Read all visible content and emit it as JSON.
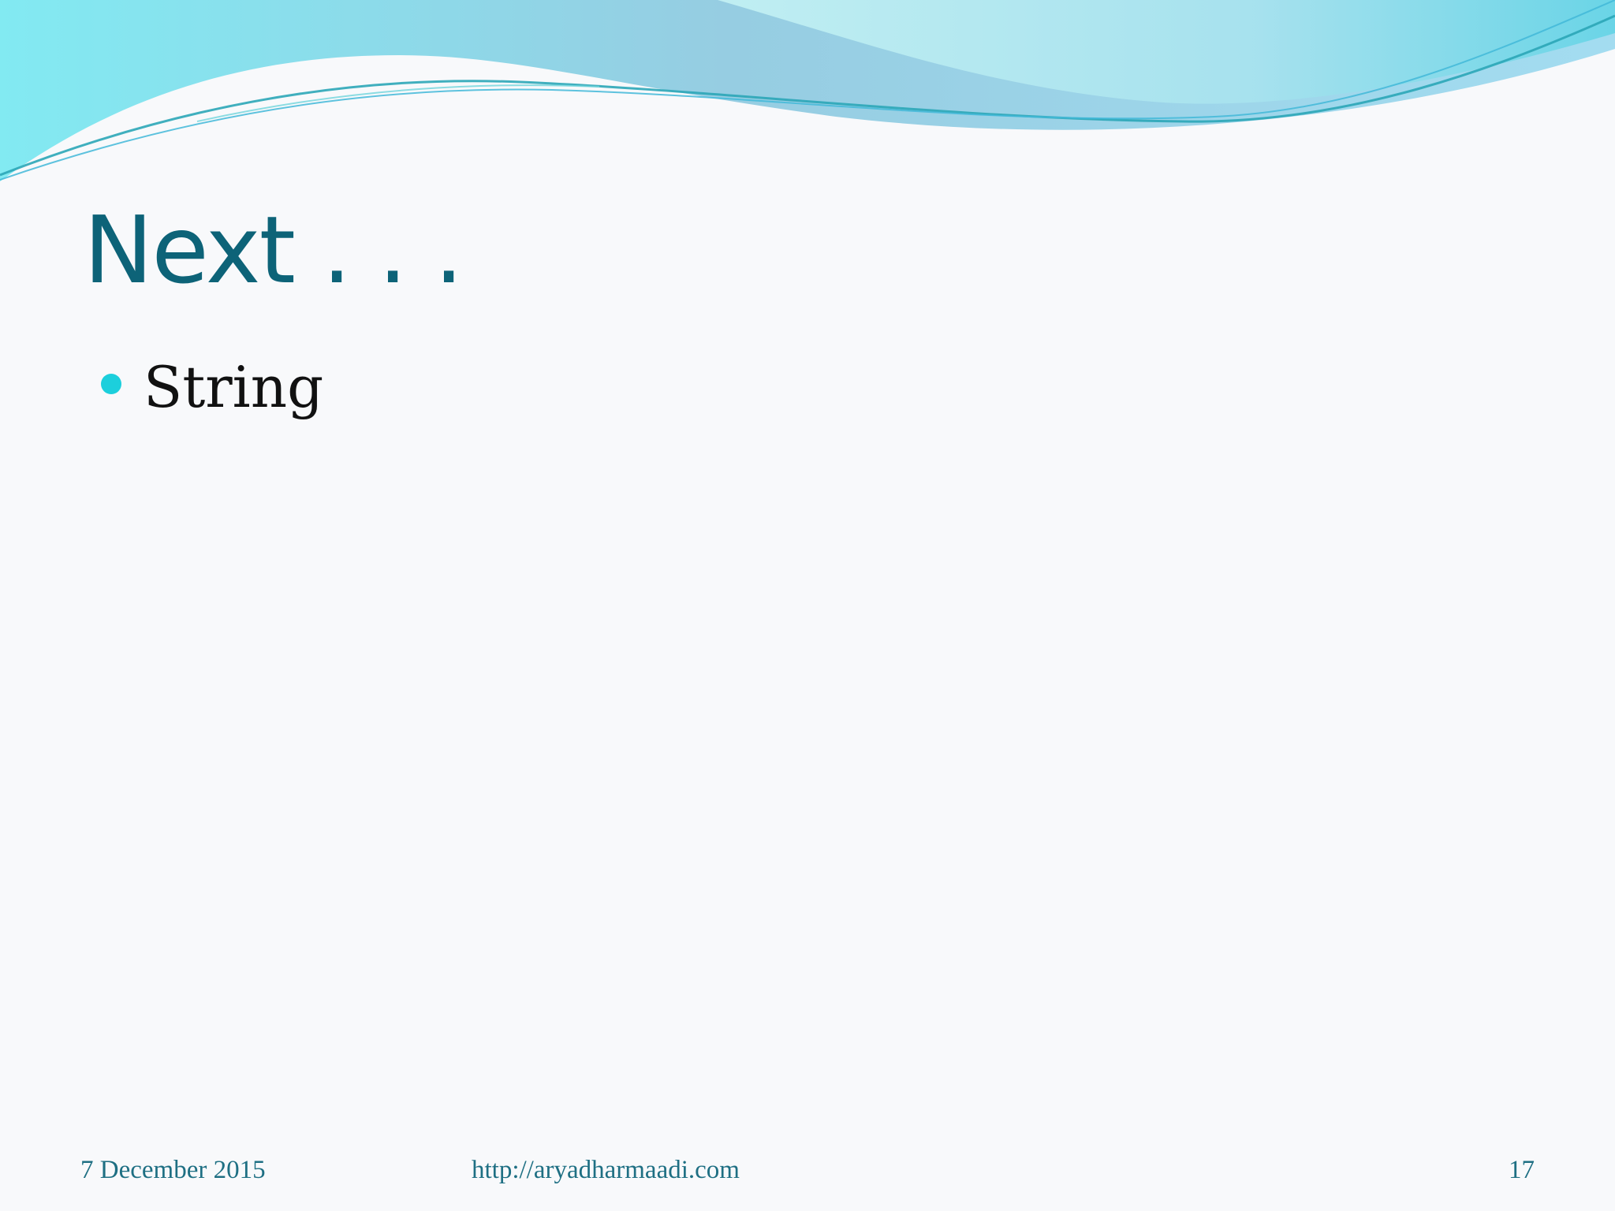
{
  "slide": {
    "title": "Next . . .",
    "bullets": [
      "String"
    ],
    "footer": {
      "date": "7 December 2015",
      "url": "http://aryadharmaadi.com",
      "page_number": "17"
    }
  },
  "colors": {
    "title": "#0d6378",
    "bullet": "#1ccfdc",
    "footer": "#1e6f83",
    "wave_light": "#78ebf2",
    "wave_dark": "#3fb5e4"
  }
}
